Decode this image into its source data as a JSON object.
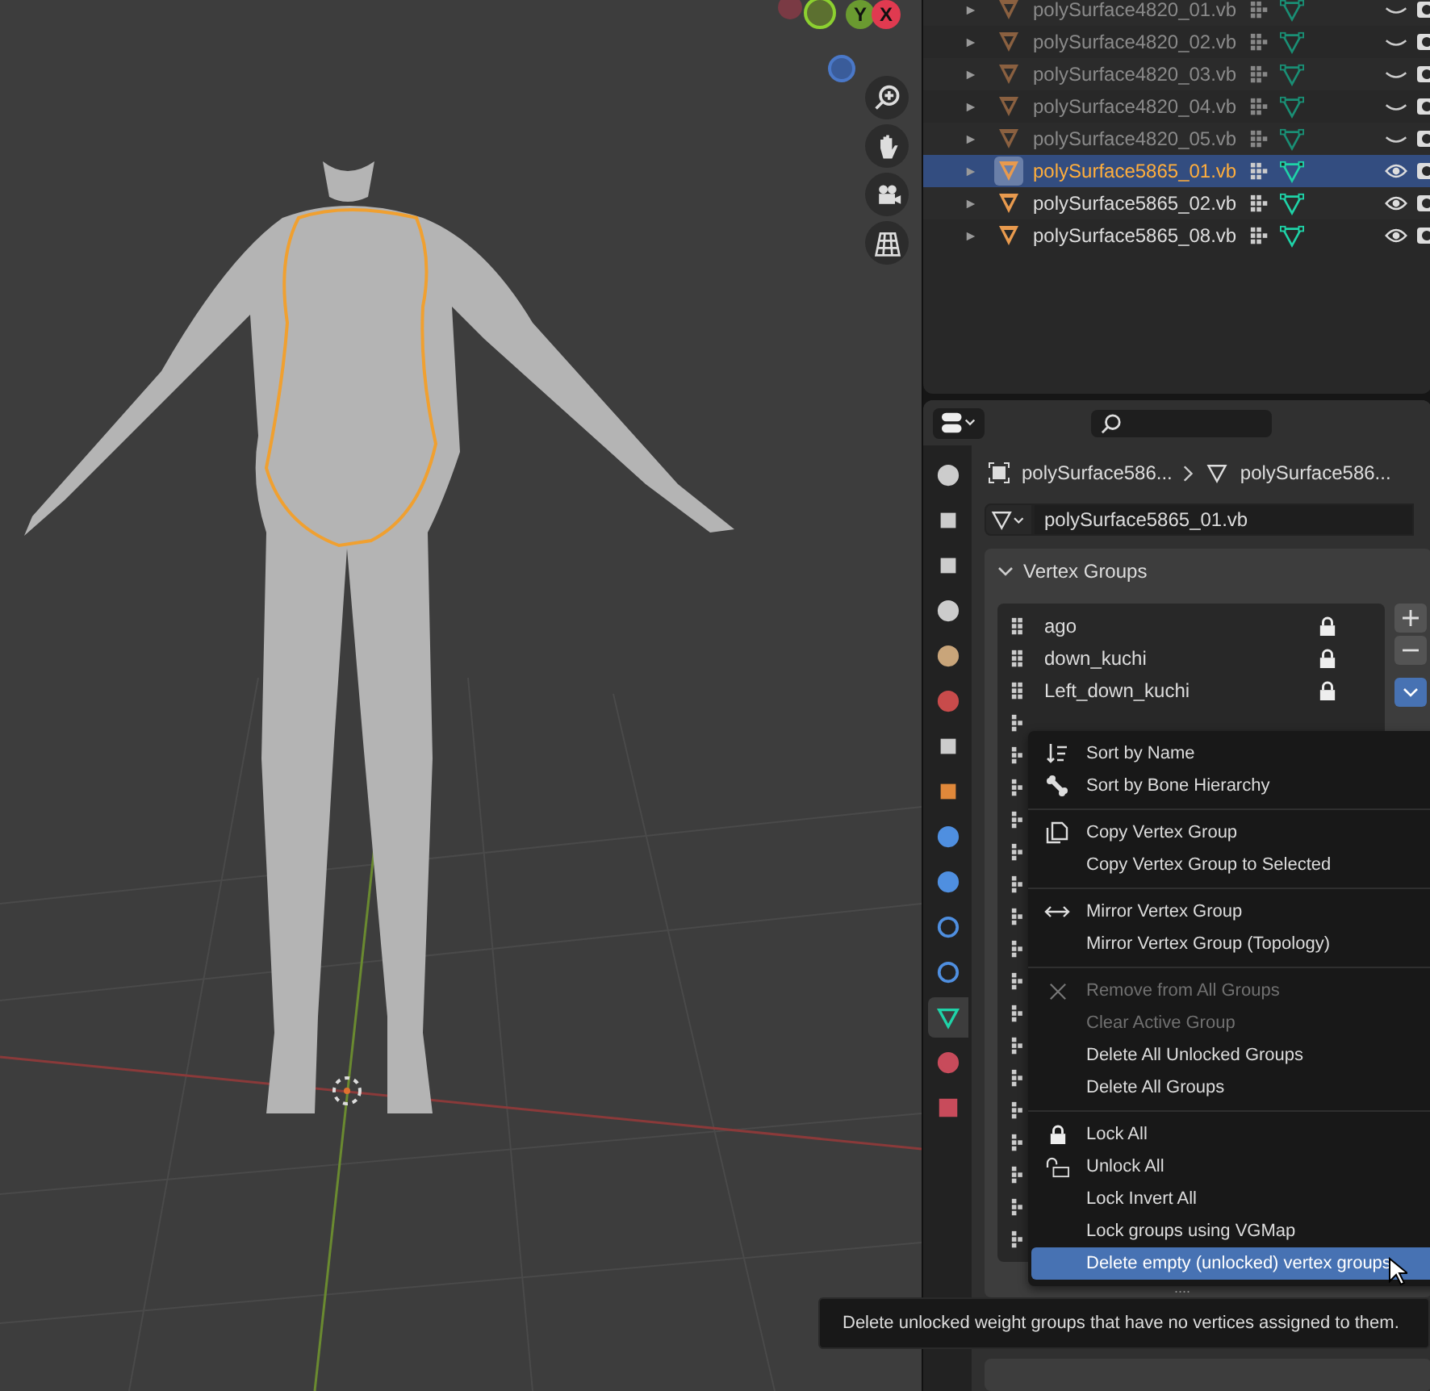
{
  "viewport": {
    "gizmo_x_label": "X",
    "gizmo_y_label": "Y"
  },
  "outliner": {
    "rows": [
      {
        "name": "polySurface4820_01.vb",
        "selected": false,
        "visible": false
      },
      {
        "name": "polySurface4820_02.vb",
        "selected": false,
        "visible": false
      },
      {
        "name": "polySurface4820_03.vb",
        "selected": false,
        "visible": false
      },
      {
        "name": "polySurface4820_04.vb",
        "selected": false,
        "visible": false
      },
      {
        "name": "polySurface4820_05.vb",
        "selected": false,
        "visible": false
      },
      {
        "name": "polySurface5865_01.vb",
        "selected": true,
        "visible": true
      },
      {
        "name": "polySurface5865_02.vb",
        "selected": false,
        "visible": true
      },
      {
        "name": "polySurface5865_08.vb",
        "selected": false,
        "visible": true
      }
    ]
  },
  "properties": {
    "tabs": [
      {
        "kind": "tool",
        "selected": false
      },
      {
        "kind": "render",
        "selected": false
      },
      {
        "kind": "output",
        "selected": false
      },
      {
        "kind": "view-layer",
        "selected": false
      },
      {
        "kind": "scene",
        "selected": false
      },
      {
        "kind": "world",
        "selected": false
      },
      {
        "kind": "collection",
        "selected": false
      },
      {
        "kind": "object",
        "selected": false
      },
      {
        "kind": "modifier",
        "selected": false
      },
      {
        "kind": "particles",
        "selected": false
      },
      {
        "kind": "physics",
        "selected": false
      },
      {
        "kind": "constraints",
        "selected": false
      },
      {
        "kind": "data",
        "selected": true
      },
      {
        "kind": "material",
        "selected": false
      },
      {
        "kind": "texture",
        "selected": false
      }
    ],
    "breadcrumb": [
      "polySurface586...",
      "polySurface586..."
    ],
    "datablock": "polySurface5865_01.vb",
    "panel_title": "Vertex Groups",
    "groups": [
      {
        "name": "ago",
        "locked": true
      },
      {
        "name": "down_kuchi",
        "locked": true
      },
      {
        "name": "Left_down_kuchi",
        "locked": true
      }
    ],
    "list_more": "...."
  },
  "menu": {
    "sections": [
      [
        {
          "label": "Sort by Name",
          "disabled": false,
          "highlighted": false
        },
        {
          "label": "Sort by Bone Hierarchy",
          "disabled": false,
          "highlighted": false
        }
      ],
      [
        {
          "label": "Copy Vertex Group",
          "disabled": false,
          "highlighted": false
        },
        {
          "label": "Copy Vertex Group to Selected",
          "disabled": false,
          "highlighted": false
        }
      ],
      [
        {
          "label": "Mirror Vertex Group",
          "disabled": false,
          "highlighted": false
        },
        {
          "label": "Mirror Vertex Group (Topology)",
          "disabled": false,
          "highlighted": false
        }
      ],
      [
        {
          "label": "Remove from All Groups",
          "disabled": true,
          "highlighted": false
        },
        {
          "label": "Clear Active Group",
          "disabled": true,
          "highlighted": false
        },
        {
          "label": "Delete All Unlocked Groups",
          "disabled": false,
          "highlighted": false
        },
        {
          "label": "Delete All Groups",
          "disabled": false,
          "highlighted": false
        }
      ],
      [
        {
          "label": "Lock All",
          "disabled": false,
          "highlighted": false
        },
        {
          "label": "Unlock All",
          "disabled": false,
          "highlighted": false
        },
        {
          "label": "Lock Invert All",
          "disabled": false,
          "highlighted": false
        },
        {
          "label": "Lock groups using VGMap",
          "disabled": false,
          "highlighted": false
        },
        {
          "label": "Delete empty (unlocked) vertex groups",
          "disabled": false,
          "highlighted": true
        }
      ]
    ]
  },
  "tooltip": "Delete unlocked weight groups that have no vertices assigned to them."
}
